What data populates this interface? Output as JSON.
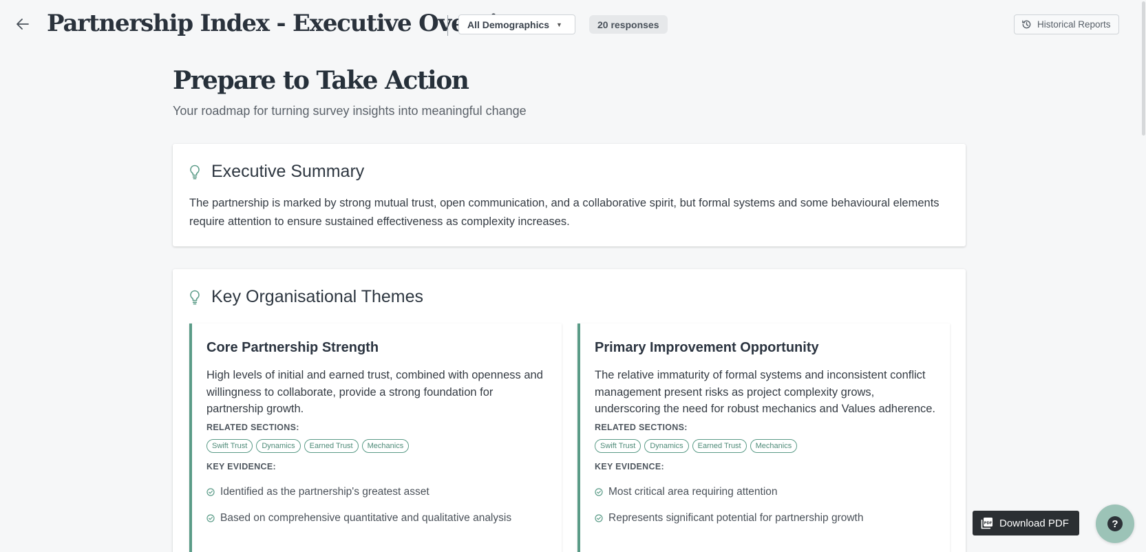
{
  "header": {
    "title": "Partnership Index - Executive Overview",
    "demographics_select": "All Demographics",
    "responses_badge": "20 responses",
    "historical_reports_label": "Historical Reports"
  },
  "page": {
    "heading": "Prepare to Take Action",
    "subheading": "Your roadmap for turning survey insights into meaningful change"
  },
  "executive_summary": {
    "title": "Executive Summary",
    "text": "The partnership is marked by strong mutual trust, open communication, and a collaborative spirit, but formal systems and some behavioural elements require attention to ensure sustained effectiveness as complexity increases."
  },
  "themes": {
    "title": "Key Organisational Themes",
    "related_label": "RELATED SECTIONS:",
    "evidence_label": "KEY EVIDENCE:",
    "items": [
      {
        "title": "Core Partnership Strength",
        "description": "High levels of initial and earned trust, combined with openness and willingness to collaborate, provide a strong foundation for partnership growth.",
        "related": [
          "Swift Trust",
          "Dynamics",
          "Earned Trust",
          "Mechanics"
        ],
        "evidence": [
          "Identified as the partnership's greatest asset",
          "Based on comprehensive quantitative and qualitative analysis"
        ]
      },
      {
        "title": "Primary Improvement Opportunity",
        "description": "The relative immaturity of formal systems and inconsistent conflict management present risks as project complexity grows, underscoring the need for robust mechanics and Values adherence.",
        "related": [
          "Swift Trust",
          "Dynamics",
          "Earned Trust",
          "Mechanics"
        ],
        "evidence": [
          "Most critical area requiring attention",
          "Represents significant potential for partnership growth"
        ]
      }
    ]
  },
  "actions": {
    "download_pdf_label": "Download PDF",
    "help_label": "?"
  },
  "colors": {
    "accent": "#5a9b87",
    "background": "#f6f7f8",
    "dark_button": "#2b2f33",
    "help_button": "#9cc3b7"
  }
}
